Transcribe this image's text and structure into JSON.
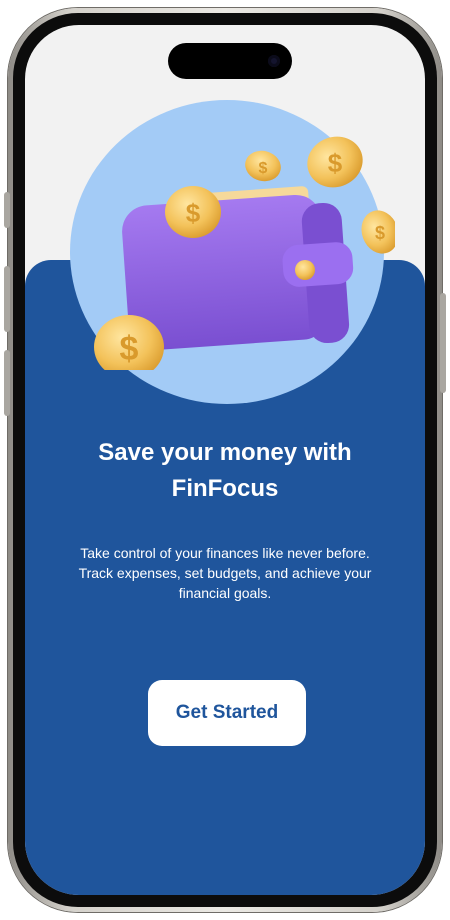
{
  "onboarding": {
    "title": "Save your money with FinFocus",
    "subtitle": "Take control of your finances like never before. Track expenses, set budgets, and achieve your financial goals.",
    "cta_label": "Get Started",
    "illustration_icon": "wallet-with-coins-icon",
    "coin_symbol": "$"
  },
  "colors": {
    "screen_top_bg": "#f2f2f2",
    "panel_bg": "#1f559c",
    "illustration_circle": "#a3cbf6",
    "wallet_purple": "#8f5fe0",
    "coin_gold": "#f3c25a",
    "cash_green": "#4cd67a",
    "button_bg": "#ffffff",
    "button_text": "#1f559c"
  }
}
